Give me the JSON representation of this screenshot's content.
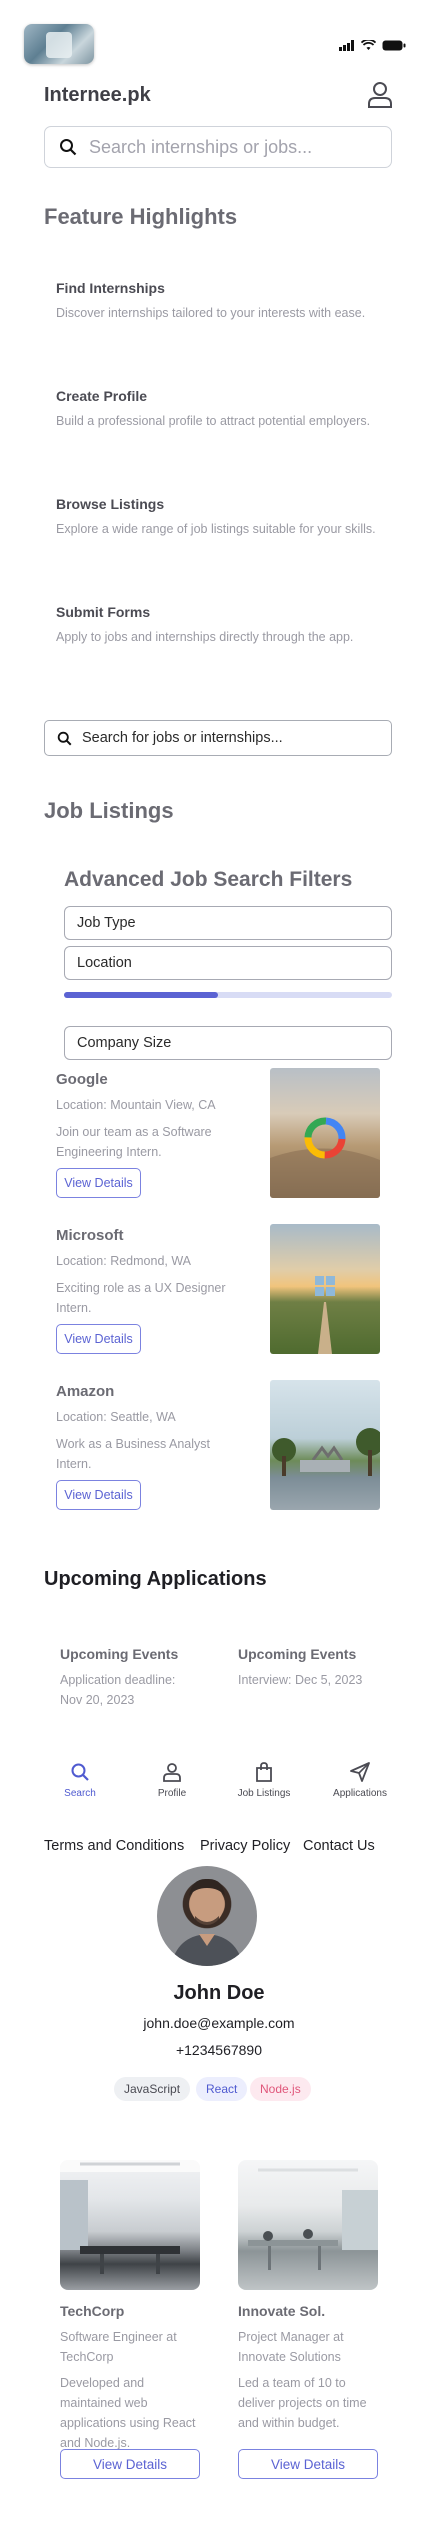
{
  "header": {
    "brand": "Internee.pk",
    "search_placeholder": "Search internships or jobs...",
    "icons": [
      "signal-icon",
      "wifi-icon",
      "battery-icon",
      "profile-icon",
      "search-icon"
    ]
  },
  "features": {
    "title": "Feature Highlights",
    "items": [
      {
        "title": "Find Internships",
        "desc": "Discover internships tailored to your interests with ease."
      },
      {
        "title": "Create Profile",
        "desc": "Build a professional profile to attract potential employers."
      },
      {
        "title": "Browse Listings",
        "desc": "Explore a wide range of job listings suitable for your skills."
      },
      {
        "title": "Submit Forms",
        "desc": "Apply to jobs and internships directly through the app."
      }
    ]
  },
  "secondary_search": {
    "placeholder": "Search for jobs or internships..."
  },
  "job_listings": {
    "title": "Job Listings",
    "filters": {
      "title": "Advanced Job Search Filters",
      "job_type": "Job Type",
      "location": "Location",
      "company_size": "Company Size",
      "progress_fraction": 0.47
    },
    "jobs": [
      {
        "company": "Google",
        "location": "Location: Mountain View, CA",
        "desc": "Join our team as a Software Engineering Intern.",
        "button": "View Details"
      },
      {
        "company": "Microsoft",
        "location": "Location: Redmond, WA",
        "desc": "Exciting role as a UX Designer Intern.",
        "button": "View Details"
      },
      {
        "company": "Amazon",
        "location": "Location: Seattle, WA",
        "desc": "Work as a Business Analyst Intern.",
        "button": "View Details"
      }
    ]
  },
  "applications": {
    "title": "Upcoming Applications",
    "events": [
      {
        "title": "Upcoming Events",
        "desc": "Application deadline: Nov 20, 2023"
      },
      {
        "title": "Upcoming Events",
        "desc": "Interview: Dec 5, 2023"
      }
    ]
  },
  "nav": {
    "items": [
      {
        "label": "Search",
        "icon": "search-icon",
        "active": true
      },
      {
        "label": "Profile",
        "icon": "user-icon",
        "active": false
      },
      {
        "label": "Job Listings",
        "icon": "bag-icon",
        "active": false
      },
      {
        "label": "Applications",
        "icon": "send-icon",
        "active": false
      }
    ],
    "active_color": "#4f5ad0"
  },
  "footer_links": [
    "Terms and Conditions",
    "Privacy Policy",
    "Contact Us"
  ],
  "profile": {
    "name": "John Doe",
    "email": "john.doe@example.com",
    "phone": "+1234567890",
    "skills": [
      {
        "label": "JavaScript",
        "bg": "#eef0f3",
        "color": "#4b4b53"
      },
      {
        "label": "React",
        "bg": "#eceefd",
        "color": "#4f5ad0"
      },
      {
        "label": "Node.js",
        "bg": "#fde9ef",
        "color": "#e0567a"
      }
    ]
  },
  "experience": [
    {
      "company": "TechCorp",
      "role": "Software Engineer at TechCorp",
      "desc": "Developed and maintained web applications using React and Node.js.",
      "button": "View Details"
    },
    {
      "company": "Innovate Sol.",
      "role": "Project Manager at Innovate Solutions",
      "desc": "Led a team of 10 to deliver projects on time and within budget.",
      "button": "View Details"
    }
  ],
  "colors": {
    "accent": "#5b63d3",
    "accent_light": "#d8dcf5"
  }
}
